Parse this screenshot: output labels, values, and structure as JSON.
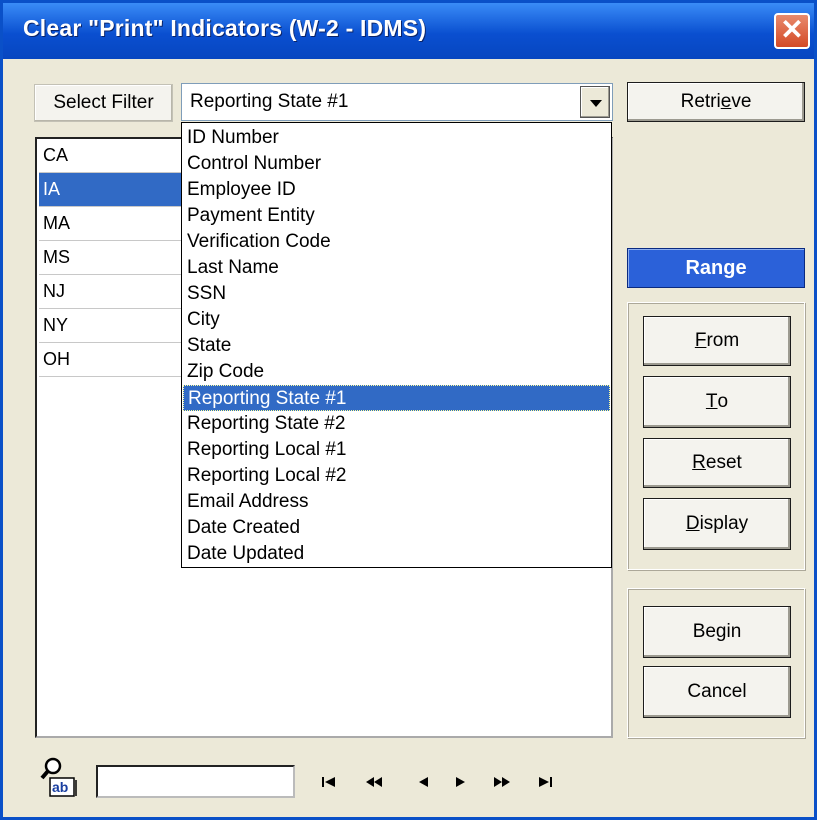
{
  "window": {
    "title": "Clear \"Print\" Indicators (W-2 - IDMS)",
    "close_label": "✕"
  },
  "filter": {
    "select_filter_label": "Select Filter",
    "combo_value": "Reporting State #1",
    "options": [
      "ID Number",
      "Control Number",
      "Employee ID",
      "Payment Entity",
      "Verification Code",
      "Last Name",
      "SSN",
      "City",
      "State",
      "Zip Code",
      "Reporting State #1",
      "Reporting State #2",
      "Reporting Local #1",
      "Reporting Local #2",
      "Email Address",
      "Date Created",
      "Date Updated"
    ],
    "selected_option": "Reporting State #1"
  },
  "list": {
    "items": [
      "CA",
      "IA",
      "MA",
      "MS",
      "NJ",
      "NY",
      "OH"
    ],
    "selected": "IA"
  },
  "buttons": {
    "retrieve": {
      "pre": "Retri",
      "key": "e",
      "post": "ve"
    },
    "range_label": "Range",
    "from": {
      "key": "F",
      "post": "rom"
    },
    "to": {
      "key": "T",
      "post": "o"
    },
    "reset": {
      "key": "R",
      "post": "eset"
    },
    "display": {
      "key": "D",
      "post": "isplay"
    },
    "begin": "Begin",
    "cancel": "Cancel"
  },
  "search": {
    "value": ""
  },
  "icons": {
    "find": "find-text-icon",
    "first": "first-record-icon",
    "prev_page": "previous-page-icon",
    "prev": "previous-record-icon",
    "next": "next-record-icon",
    "next_page": "next-page-icon",
    "last": "last-record-icon"
  },
  "colors": {
    "title_bar": "#0a4fd0",
    "selection": "#316ac5",
    "range_bar": "#2b61d9",
    "window_bg": "#ece9d8"
  }
}
